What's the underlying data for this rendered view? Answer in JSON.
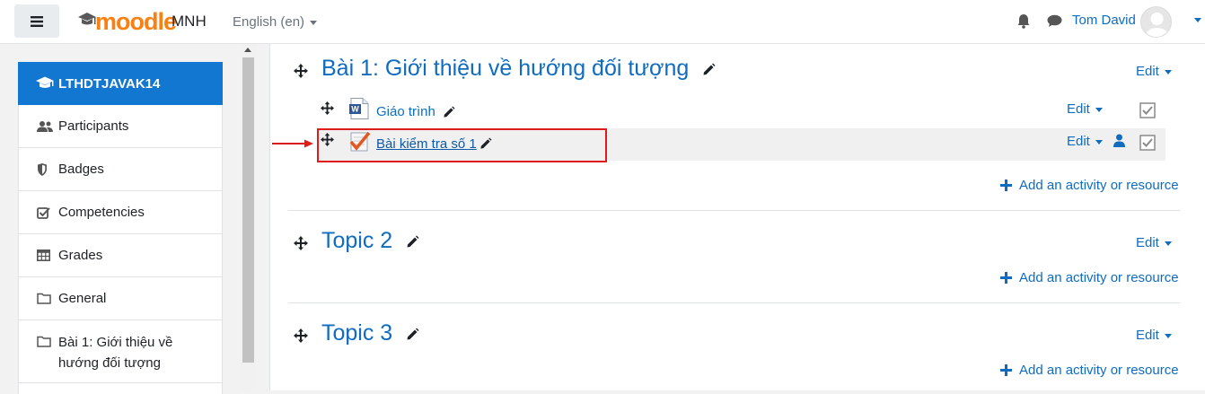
{
  "navbar": {
    "logo_text": "moodle",
    "site_name": "MNH",
    "language": "English (en)",
    "user_name": "Tom David"
  },
  "drawer": {
    "course": "LTHDTJAVAK14",
    "items": [
      {
        "label": "Participants",
        "icon": "users-icon"
      },
      {
        "label": "Badges",
        "icon": "shield-icon"
      },
      {
        "label": "Competencies",
        "icon": "checkbox-icon"
      },
      {
        "label": "Grades",
        "icon": "table-icon"
      },
      {
        "label": "General",
        "icon": "folder-icon"
      },
      {
        "label": "Bài 1: Giới thiệu về hướng đối tượng",
        "icon": "folder-icon"
      }
    ]
  },
  "sections": [
    {
      "title": "Bài 1: Giới thiệu về hướng đối tượng",
      "edit_label": "Edit",
      "add_label": "Add an activity or resource",
      "activities": [
        {
          "name": "Giáo trình",
          "type": "word-document",
          "edit_label": "Edit"
        },
        {
          "name": "Bài kiểm tra số 1",
          "type": "quiz",
          "edit_label": "Edit"
        }
      ]
    },
    {
      "title": "Topic 2",
      "edit_label": "Edit",
      "add_label": "Add an activity or resource"
    },
    {
      "title": "Topic 3",
      "edit_label": "Edit",
      "add_label": "Add an activity or resource"
    }
  ],
  "colors": {
    "link": "#0f6cbf",
    "course_bg": "#1177d1",
    "brand_orange": "#f98012",
    "highlight": "#e01b1b"
  }
}
